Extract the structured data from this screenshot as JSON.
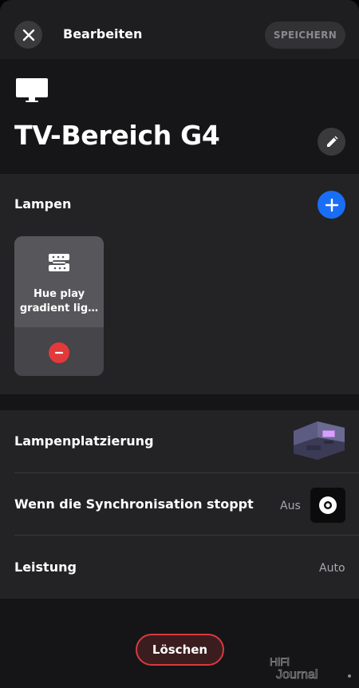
{
  "topbar": {
    "title": "Bearbeiten",
    "save_label": "SPEICHERN"
  },
  "room": {
    "name": "TV-Bereich G4",
    "icon": "tv-icon"
  },
  "lamps": {
    "title": "Lampen",
    "items": [
      {
        "name": "Hue play gradient lig…",
        "icon": "lightstrip-icon"
      }
    ]
  },
  "settings": {
    "placement_label": "Lampenplatzierung",
    "sync_stop_label": "Wenn die Synchronisation stoppt",
    "sync_stop_value": "Aus",
    "power_label": "Leistung",
    "power_value": "Auto"
  },
  "delete_label": "Löschen",
  "watermark": "HiFi Journal",
  "colors": {
    "accent_blue": "#1a6ef5",
    "danger_red": "#d9393f",
    "background": "#1a1a1c"
  }
}
